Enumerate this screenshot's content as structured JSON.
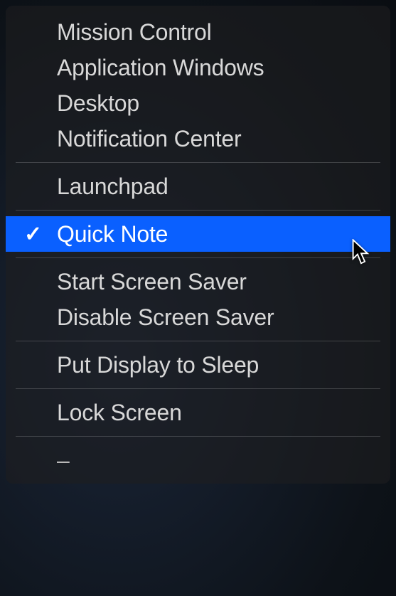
{
  "menu": {
    "group1": [
      {
        "label": "Mission Control"
      },
      {
        "label": "Application Windows"
      },
      {
        "label": "Desktop"
      },
      {
        "label": "Notification Center"
      }
    ],
    "group2": [
      {
        "label": "Launchpad"
      }
    ],
    "group3": [
      {
        "label": "Quick Note",
        "selected": true,
        "checked": true
      }
    ],
    "group4": [
      {
        "label": "Start Screen Saver"
      },
      {
        "label": "Disable Screen Saver"
      }
    ],
    "group5": [
      {
        "label": "Put Display to Sleep"
      }
    ],
    "group6": [
      {
        "label": "Lock Screen"
      }
    ],
    "group7": [
      {
        "label": "–"
      }
    ]
  }
}
